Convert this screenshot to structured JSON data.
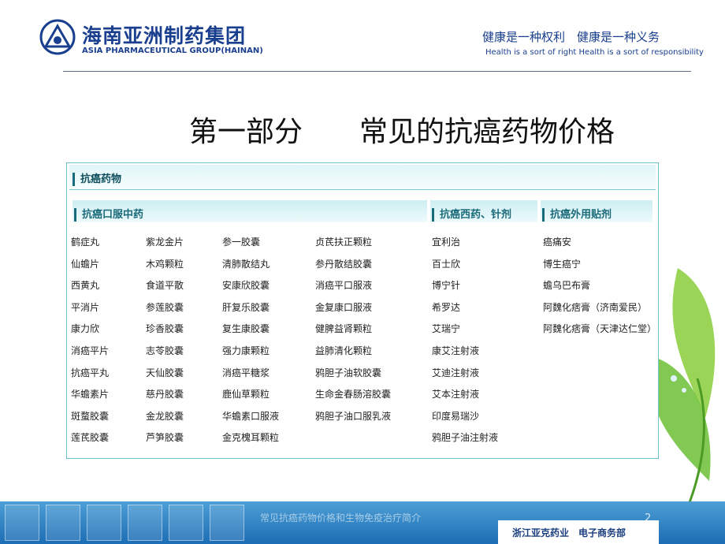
{
  "header": {
    "company_cn": "海南亚洲制药集团",
    "company_en": "ASIA PHARMACEUTICAL GROUP(HAINAN)",
    "slogan_cn": "健康是一种权利　健康是一种义务",
    "slogan_en": "Health is a sort of right  Health is a sort of responsibility",
    "logo_icon": "asia-pharma-triangle-logo"
  },
  "title": "第一部分　　常见的抗癌药物价格",
  "panel": {
    "title": "抗癌药物",
    "sections": [
      {
        "title": "抗癌口服中药"
      },
      {
        "title": "抗癌西药、针剂"
      },
      {
        "title": "抗癌外用贴剂"
      }
    ],
    "columns": [
      [
        "鹤症丸",
        "仙蟾片",
        "西黄丸",
        "平消片",
        "康力欣",
        "消癌平片",
        "抗癌平丸",
        "华蟾素片",
        "斑蝥胶囊",
        "莲芪胶囊"
      ],
      [
        "紫龙金片",
        "木鸡颗粒",
        "食道平散",
        "参莲胶囊",
        "珍香胶囊",
        "志苓胶囊",
        "天仙胶囊",
        "慈丹胶囊",
        "金龙胶囊",
        "芦笋胶囊"
      ],
      [
        "参一胶囊",
        "清肺散结丸",
        "安康欣胶囊",
        "肝复乐胶囊",
        "复生康胶囊",
        "强力康颗粒",
        "消癌平糖浆",
        "鹿仙草颗粒",
        "华蟾素口服液",
        "金克槐耳颗粒"
      ],
      [
        "贞芪扶正颗粒",
        "参丹散结胶囊",
        "消癌平口服液",
        "金复康口服液",
        "健脾益肾颗粒",
        "益肺清化颗粒",
        "鸦胆子油软胶囊",
        "生命金春肠溶胶囊",
        "鸦胆子油口服乳液"
      ],
      [
        "宜利治",
        "百士欣",
        "博宁针",
        "希罗达",
        "艾瑞宁",
        "康艾注射液",
        "艾迪注射液",
        "艾本注射液",
        "印度易瑞沙",
        "鸦胆子油注射液"
      ],
      [
        "癌痛安",
        "博生癌宁",
        "蟾乌巴布膏",
        "阿魏化痞膏（济南爱民）",
        "阿魏化痞膏（天津达仁堂）"
      ]
    ]
  },
  "footer": {
    "caption": "常见抗癌药物价格和生物免疫治疗简介",
    "page_number": "2",
    "tag": "浙江亚克药业　电子商务部"
  },
  "colors": {
    "brand_blue": "#1a3f8f",
    "panel_teal": "#6fc3cf",
    "footer_blue": "#2a7cc0",
    "leaf_green": "#7cc63e"
  }
}
